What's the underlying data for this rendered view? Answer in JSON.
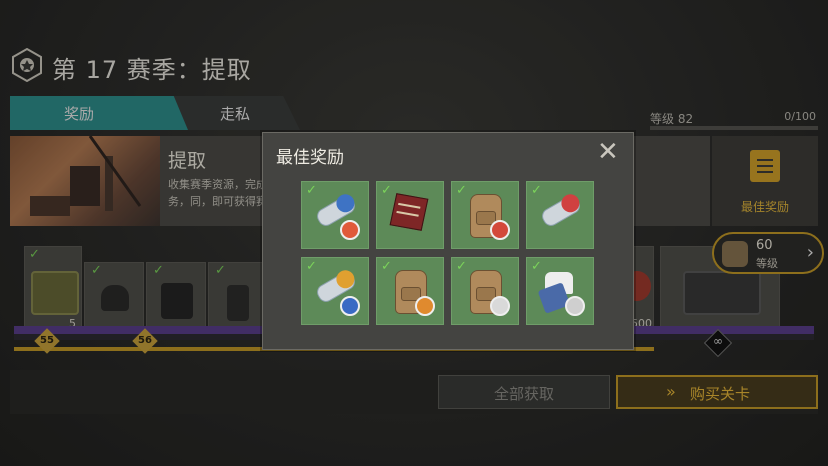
{
  "header": {
    "title": "第 17 赛季：提取"
  },
  "tabs": [
    {
      "label": "奖励",
      "active": true
    },
    {
      "label": "走私",
      "active": false
    }
  ],
  "level": {
    "label": "等级 82",
    "progress": "0/100",
    "progress_fraction": 0
  },
  "banner": {
    "title": "提取",
    "description": "收集赛季资源，完成任务，同，即可获得赛季"
  },
  "best_rewards_panel": {
    "label": "最佳奖励",
    "icon": "clipboard-icon",
    "accent": "#e4b83c"
  },
  "track": {
    "levels": [
      "55",
      "56"
    ],
    "quantities": [
      "5",
      "500"
    ],
    "infinity": "∞"
  },
  "next_reward": {
    "level": "60",
    "level_label": "等级"
  },
  "buttons": {
    "claim_all": "全部获取",
    "buy_levels": "购买关卡",
    "buy_icon": "double-chevron-icon"
  },
  "modal": {
    "title": "最佳奖励",
    "close": "✕",
    "items": [
      {
        "name": "sleeping-mat",
        "claimed": true,
        "badge": "#e05a3a"
      },
      {
        "name": "camp-chair",
        "claimed": true,
        "badge": ""
      },
      {
        "name": "backpack",
        "claimed": true,
        "badge": "#d3493b"
      },
      {
        "name": "sleeping-mat",
        "claimed": true,
        "badge": "#d04040"
      },
      {
        "name": "sleeping-mat",
        "claimed": true,
        "badge": "#e0a030"
      },
      {
        "name": "backpack",
        "claimed": true,
        "badge": "#e08a2e"
      },
      {
        "name": "backpack",
        "claimed": true,
        "badge": "#d9d9d9"
      },
      {
        "name": "tank-top-jeans",
        "claimed": true,
        "badge": "#cfcfcf"
      }
    ]
  },
  "colors": {
    "tab_active": "#2f8f8c",
    "gold": "#c49a28",
    "slot": "#5d8a58",
    "check": "#7bd35a",
    "track_purple": "#5b3f8c"
  }
}
